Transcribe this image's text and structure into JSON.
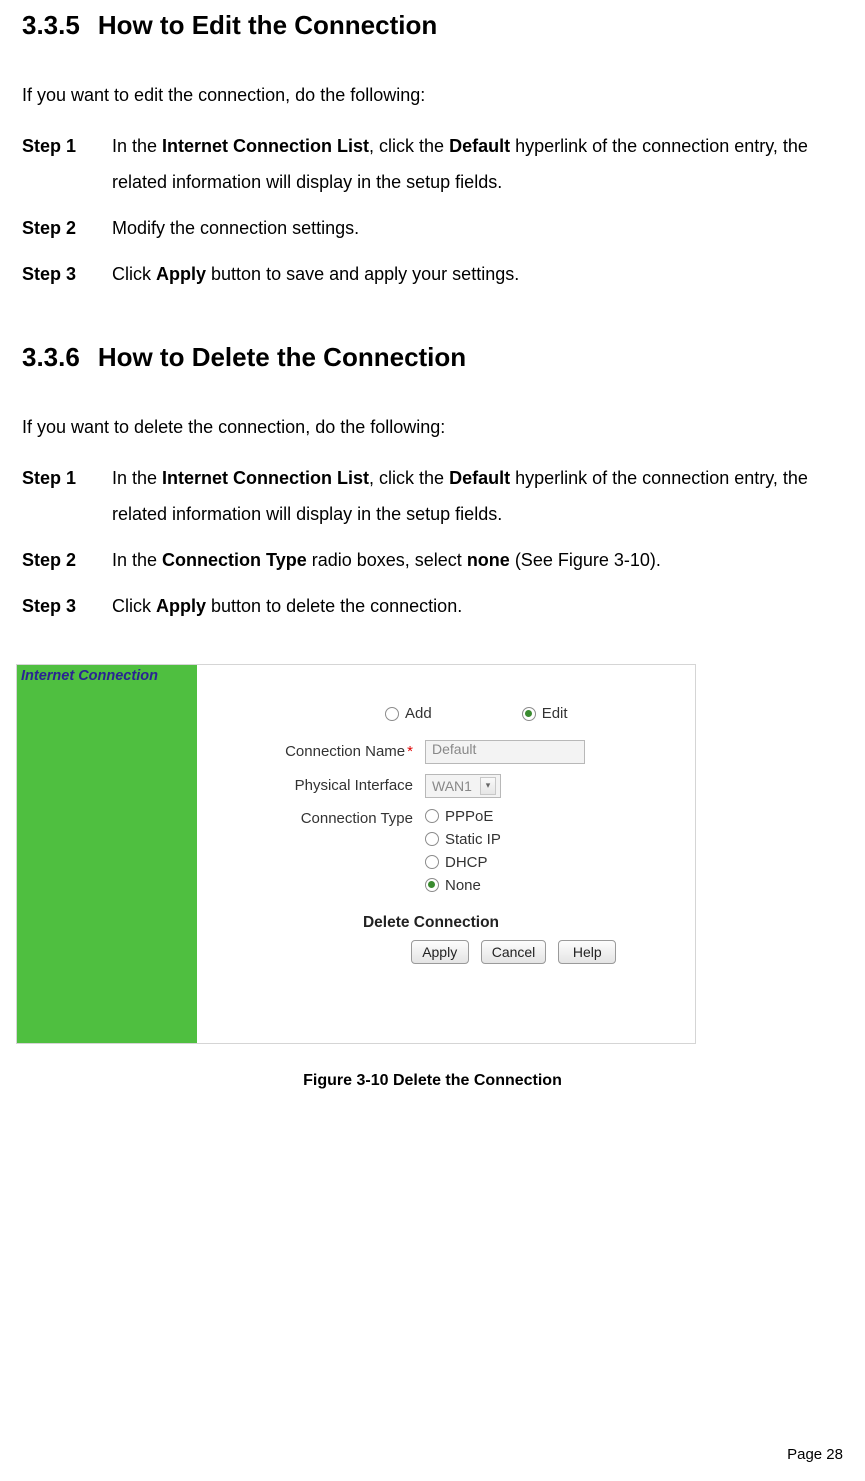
{
  "section335": {
    "number": "3.3.5",
    "title": "How to Edit the Connection",
    "intro": "If you want to edit the connection, do the following:",
    "steps": [
      {
        "label": "Step 1",
        "pre": "In the ",
        "bold1": "Internet Connection List",
        "mid": ", click the ",
        "bold2": "Default",
        "post": " hyperlink of the connection entry, the related information will display in the setup fields."
      },
      {
        "label": "Step 2",
        "plain": "Modify the connection settings."
      },
      {
        "label": "Step 3",
        "pre": "Click ",
        "bold1": "Apply",
        "post": " button to save and apply your settings."
      }
    ]
  },
  "section336": {
    "number": "3.3.6",
    "title": "How to Delete the Connection",
    "intro": "If you want to delete the connection, do the following:",
    "steps": [
      {
        "label": "Step 1",
        "pre": "In the ",
        "bold1": "Internet Connection List",
        "mid": ", click the ",
        "bold2": "Default",
        "post": " hyperlink of the connection entry, the related information will display in the setup fields."
      },
      {
        "label": "Step 2",
        "pre": "In the ",
        "bold1": "Connection Type",
        "mid": " radio boxes, select ",
        "bold2": "none",
        "post": " (See Figure 3-10)."
      },
      {
        "label": "Step 3",
        "pre": "Click ",
        "bold1": "Apply",
        "post": " button to delete the connection."
      }
    ]
  },
  "figure": {
    "sidebar_title": "Internet Connection",
    "mode": {
      "add": "Add",
      "edit": "Edit",
      "selected": "edit"
    },
    "fields": {
      "conn_name_label": "Connection Name",
      "conn_name_value": "Default",
      "phy_if_label": "Physical Interface",
      "phy_if_value": "WAN1",
      "conn_type_label": "Connection Type"
    },
    "conn_types": [
      {
        "label": "PPPoE",
        "selected": false
      },
      {
        "label": "Static IP",
        "selected": false
      },
      {
        "label": "DHCP",
        "selected": false
      },
      {
        "label": "None",
        "selected": true
      }
    ],
    "delete_label": "Delete Connection",
    "buttons": {
      "apply": "Apply",
      "cancel": "Cancel",
      "help": "Help"
    },
    "caption": "Figure 3-10 Delete the Connection"
  },
  "page_footer": "Page 28"
}
